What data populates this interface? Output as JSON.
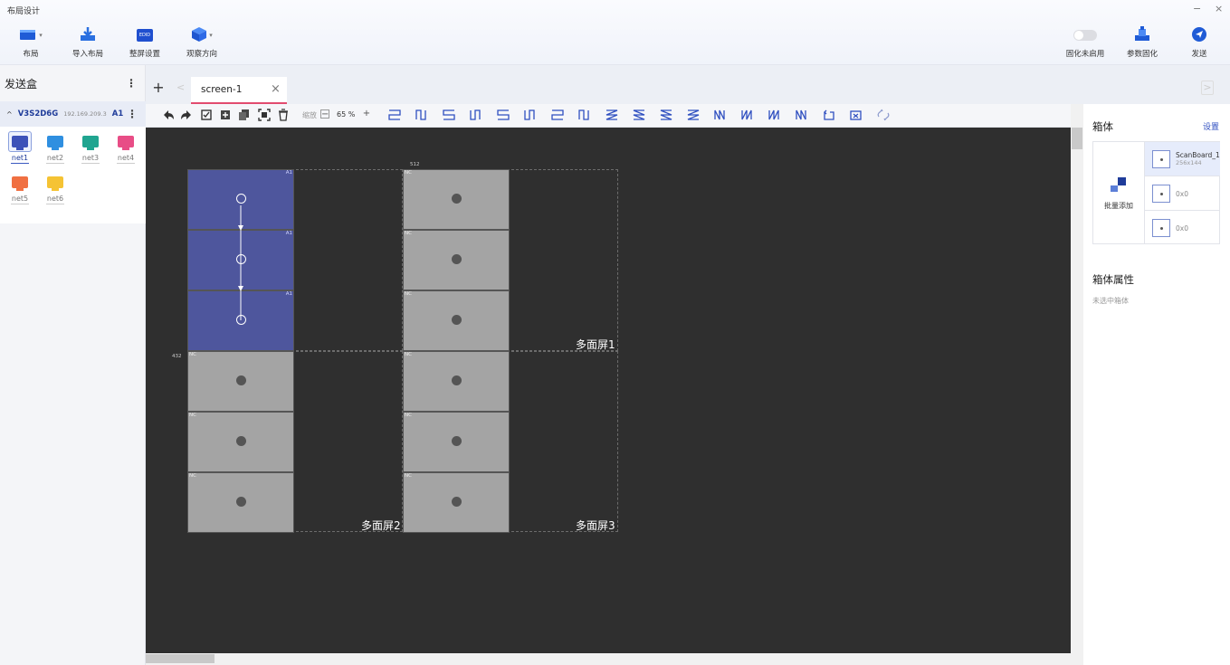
{
  "app": {
    "title": "布局设计",
    "minimize": "−",
    "close": "×"
  },
  "toolbar": {
    "layout": "布局",
    "import_layout": "导入布局",
    "screen_settings": "整屏设置",
    "view_direction": "观察方向",
    "edid_badge": "EDID",
    "fix_toggle": "固化未启用",
    "param_fix": "参数固化",
    "send": "发送"
  },
  "left_panel": {
    "title": "发送盒",
    "device": {
      "name": "V3S2D6G",
      "ip": "192.169.209.3",
      "port": "A1"
    },
    "nets": [
      {
        "label": "net1",
        "color": "#3d52b8",
        "selected": true
      },
      {
        "label": "net2",
        "color": "#2f8fe0",
        "selected": false
      },
      {
        "label": "net3",
        "color": "#20a590",
        "selected": false
      },
      {
        "label": "net4",
        "color": "#e84d86",
        "selected": false
      },
      {
        "label": "net5",
        "color": "#f07042",
        "selected": false
      },
      {
        "label": "net6",
        "color": "#f5c334",
        "selected": false
      }
    ]
  },
  "tabs": {
    "add": "+",
    "prev": "<",
    "next": ">",
    "items": [
      {
        "label": "screen-1",
        "close": "×"
      }
    ]
  },
  "edit_toolbar": {
    "zoom_label": "缩放",
    "zoom_value": "65 %",
    "zoom_minus": "−",
    "zoom_plus": "+"
  },
  "canvas": {
    "ruler_top": "512",
    "ruler_left": "432",
    "cabinet_nc": "NC",
    "cabinet_corner": "A1",
    "regions": [
      {
        "label": "多面屏1"
      },
      {
        "label": "多面屏2"
      },
      {
        "label": "多面屏3"
      }
    ]
  },
  "right_panel": {
    "title": "箱体",
    "settings": "设置",
    "batch_add": "批量添加",
    "cabinet_types": [
      {
        "name": "ScanBoard_1",
        "size": "256x144",
        "selected": true
      },
      {
        "name": "",
        "size": "0x0",
        "selected": false
      },
      {
        "name": "",
        "size": "0x0",
        "selected": false
      }
    ],
    "properties_title": "箱体属性",
    "properties_empty": "未选中箱体"
  },
  "colors": {
    "accent": "#3a59c0",
    "tab_underline": "#e24b6e",
    "canvas_bg": "#2f2f2f",
    "cabinet_blue": "#4e569d",
    "cabinet_gray": "#a4a4a4"
  }
}
